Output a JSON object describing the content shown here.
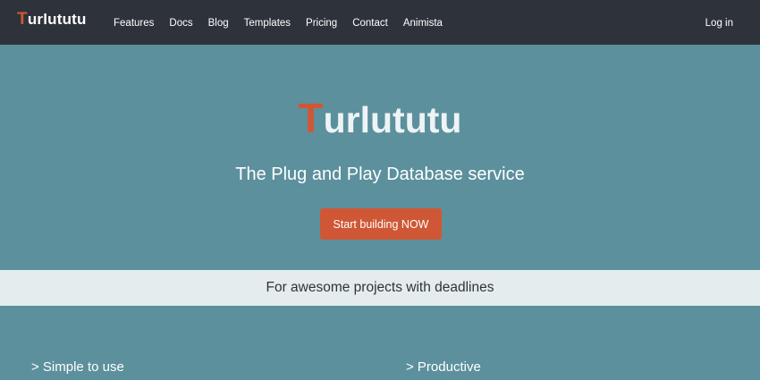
{
  "brand": {
    "accent_letter": "T",
    "rest": "urlututu",
    "accent_color": "#cf5735"
  },
  "nav": {
    "items": [
      {
        "label": "Features"
      },
      {
        "label": "Docs"
      },
      {
        "label": "Blog"
      },
      {
        "label": "Templates"
      },
      {
        "label": "Pricing"
      },
      {
        "label": "Contact"
      },
      {
        "label": "Animista"
      }
    ],
    "login_label": "Log in"
  },
  "hero": {
    "title_accent": "T",
    "title_rest": "urlututu",
    "tagline": "The Plug and Play Database service",
    "cta_label": "Start building NOW",
    "background_color": "#5c909d"
  },
  "banner": {
    "text": "For awesome projects with deadlines"
  },
  "features": {
    "items": [
      {
        "heading": "> Simple to use"
      },
      {
        "heading": "> Productive"
      }
    ]
  }
}
